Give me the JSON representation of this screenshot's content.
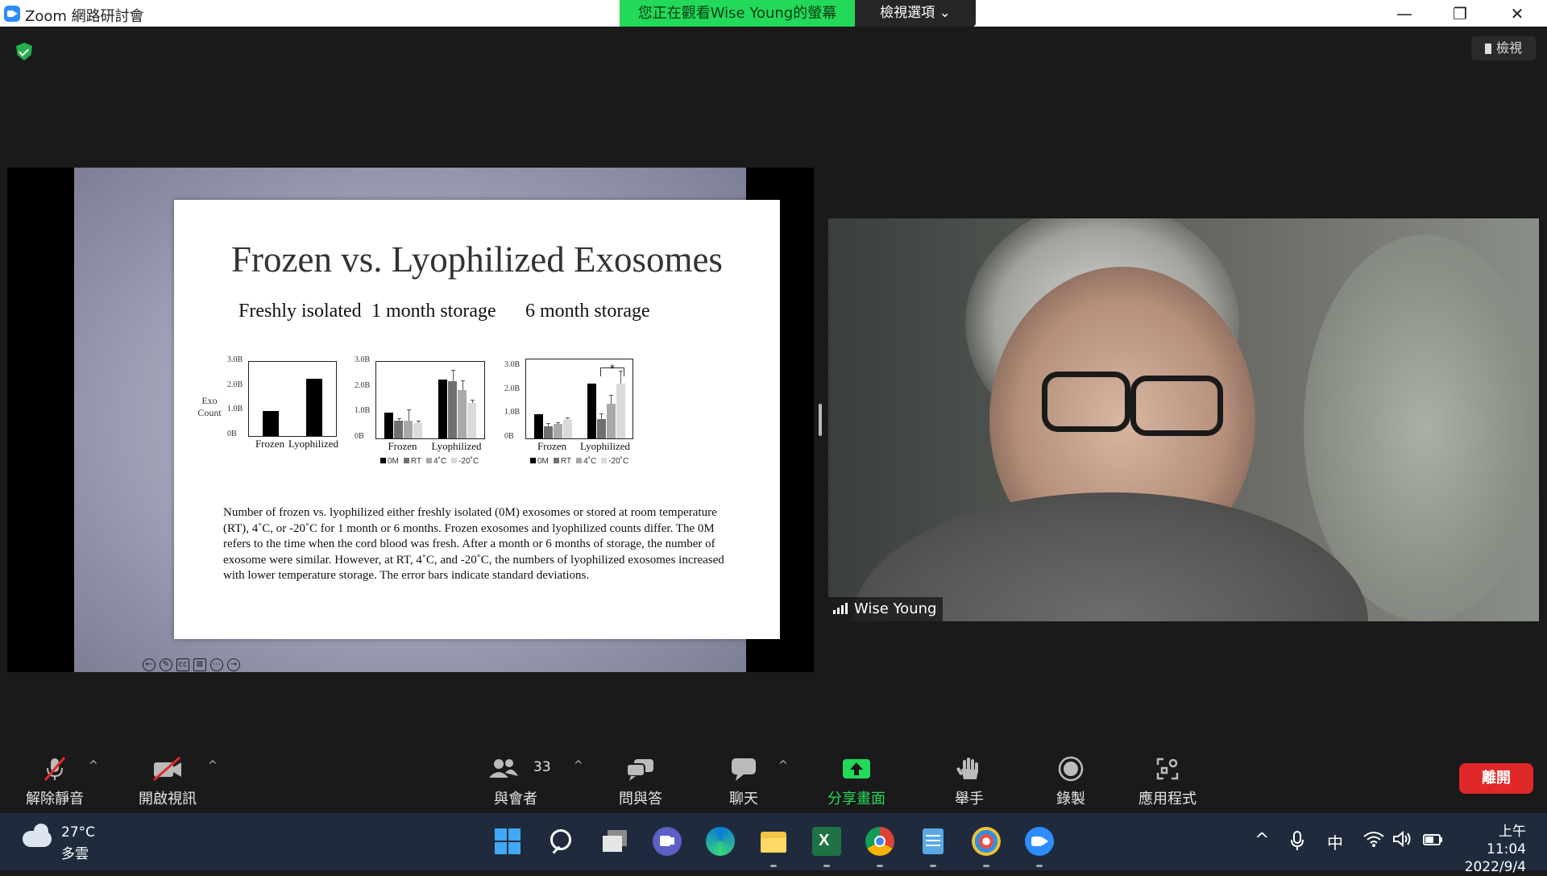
{
  "window": {
    "title": "Zoom 網路研討會",
    "viewing_banner": "您正在觀看Wise Young的螢幕",
    "view_options": "檢視選項",
    "view_button": "檢視",
    "minimize": "—",
    "restore": "❐",
    "close": "✕"
  },
  "slide": {
    "title": "Frozen vs. Lyophilized Exosomes",
    "y_axis_label_line1": "Exo",
    "y_axis_label_line2": "Count",
    "caption": "Number of frozen vs. lyophilized either freshly isolated (0M) exosomes or stored at room temperature (RT), 4˚C, or -20˚C for 1 month or 6 months.  Frozen exosomes and lyophilized counts differ.  The 0M refers to the time when the cord blood was fresh.  After a month or 6 months of storage, the number of exosome were similar.  However, at RT, 4˚C, and -20˚C, the numbers of lyophilized exosomes increased with lower temperature storage.  The error bars indicate standard deviations."
  },
  "chart_data": [
    {
      "type": "bar",
      "title": "Freshly isolated",
      "categories": [
        "Frozen",
        "Lyophilized"
      ],
      "yticks": [
        "3.0B",
        "2.0B",
        "1.0B",
        "0B"
      ],
      "ylim": [
        0,
        3.0
      ],
      "ylabel": "Exo Count",
      "series": [
        {
          "values": [
            1.0,
            2.3
          ]
        }
      ]
    },
    {
      "type": "bar",
      "title": "1 month storage",
      "categories": [
        "Frozen",
        "Lyophilized"
      ],
      "yticks": [
        "3.0B",
        "2.0B",
        "1.0B",
        "0B"
      ],
      "ylim": [
        0,
        3.0
      ],
      "legend": [
        "0M",
        "RT",
        "4˚C",
        "-20˚C"
      ],
      "series": [
        {
          "name": "0M",
          "values": [
            1.0,
            2.3
          ],
          "err": [
            0,
            0
          ]
        },
        {
          "name": "RT",
          "values": [
            0.7,
            2.25
          ],
          "err": [
            0.05,
            0.4
          ]
        },
        {
          "name": "4˚C",
          "values": [
            0.7,
            1.9
          ],
          "err": [
            0.4,
            0.35
          ]
        },
        {
          "name": "-20˚C",
          "values": [
            0.6,
            1.4
          ],
          "err": [
            0.05,
            0.1
          ]
        }
      ]
    },
    {
      "type": "bar",
      "title": "6 month storage",
      "categories": [
        "Frozen",
        "Lyophilized"
      ],
      "yticks": [
        "3.0B",
        "2.0B",
        "1.0B",
        "0B"
      ],
      "ylim": [
        0,
        3.3
      ],
      "legend": [
        "0M",
        "RT",
        "4˚C",
        "-20˚C"
      ],
      "annotation": "*",
      "series": [
        {
          "name": "0M",
          "values": [
            1.0,
            2.3
          ],
          "err": [
            0,
            0
          ]
        },
        {
          "name": "RT",
          "values": [
            0.5,
            0.8
          ],
          "err": [
            0.1,
            0.2
          ]
        },
        {
          "name": "4˚C",
          "values": [
            0.6,
            1.45
          ],
          "err": [
            0.05,
            0.35
          ]
        },
        {
          "name": "-20˚C",
          "values": [
            0.8,
            2.3
          ],
          "err": [
            0.05,
            0.5
          ]
        }
      ]
    }
  ],
  "colors": {
    "0M": "#000000",
    "RT": "#707070",
    "4C": "#a9a9a9",
    "-20C": "#dadada",
    "banner": "#23d959",
    "leave": "#e02828"
  },
  "video": {
    "participant_name": "Wise Young"
  },
  "toolbar": {
    "unmute": "解除靜音",
    "start_video": "開啟視訊",
    "participants": "與會者",
    "participants_count": "33",
    "qa": "問與答",
    "chat": "聊天",
    "share_screen": "分享畫面",
    "raise_hand": "舉手",
    "record": "錄製",
    "apps": "應用程式",
    "leave": "離開"
  },
  "taskbar": {
    "weather_temp": "27°C",
    "weather_cond": "多雲",
    "ime": "中",
    "time": "上午 11:04",
    "date": "2022/9/4",
    "up_arrow": "^"
  },
  "icons": [
    "shield-icon",
    "mic-off-icon",
    "video-off-icon",
    "participants-icon",
    "qa-icon",
    "chat-icon",
    "share-icon",
    "hand-icon",
    "record-icon",
    "apps-icon",
    "windows-start-icon",
    "search-icon",
    "signal-icon"
  ]
}
